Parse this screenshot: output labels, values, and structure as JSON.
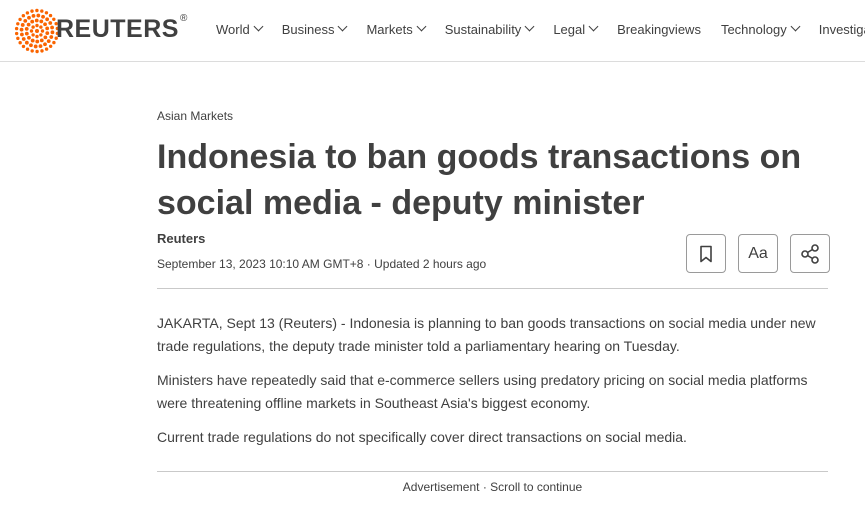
{
  "header": {
    "brand": "REUTERS",
    "registered_mark": "®",
    "nav": [
      {
        "label": "World",
        "has_dropdown": true
      },
      {
        "label": "Business",
        "has_dropdown": true
      },
      {
        "label": "Markets",
        "has_dropdown": true
      },
      {
        "label": "Sustainability",
        "has_dropdown": true
      },
      {
        "label": "Legal",
        "has_dropdown": true
      },
      {
        "label": "Breakingviews",
        "has_dropdown": false
      },
      {
        "label": "Technology",
        "has_dropdown": true
      },
      {
        "label": "Investiga",
        "has_dropdown": false
      }
    ],
    "accent_color": "#fa6400"
  },
  "article": {
    "kicker": "Asian Markets",
    "headline": "Indonesia to ban goods transactions on social media - deputy minister",
    "byline": "Reuters",
    "dateline": "September 13, 2023 10:10 AM GMT+8 · Updated 2 hours ago",
    "tools": {
      "bookmark_icon": "bookmark-icon",
      "text_size_label": "Aa",
      "share_icon": "share-icon"
    },
    "paragraphs": [
      "JAKARTA, Sept 13 (Reuters) - Indonesia is planning to ban goods transactions on social media under new trade regulations, the deputy trade minister told a parliamentary hearing on Tuesday.",
      "Ministers have repeatedly said that e-commerce sellers using predatory pricing on social media platforms were threatening offline markets in Southeast Asia's biggest economy.",
      "Current trade regulations do not specifically cover direct transactions on social media."
    ],
    "ad_notice": "Advertisement · Scroll to continue"
  }
}
